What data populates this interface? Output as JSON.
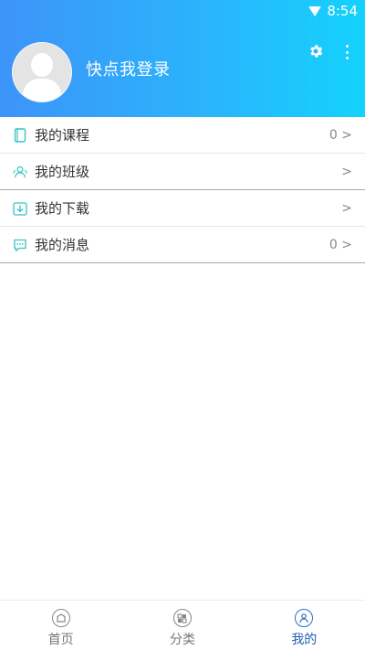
{
  "status_bar": {
    "time": "8:54"
  },
  "profile": {
    "login_prompt": "快点我登录"
  },
  "menu_items": [
    {
      "label": "我的课程",
      "count": "0",
      "arrow": ">"
    },
    {
      "label": "我的班级",
      "count": "",
      "arrow": ">"
    },
    {
      "label": "我的下载",
      "count": "",
      "arrow": ">"
    },
    {
      "label": "我的消息",
      "count": "0",
      "arrow": ">"
    }
  ],
  "tabs": [
    {
      "label": "首页"
    },
    {
      "label": "分类"
    },
    {
      "label": "我的"
    }
  ],
  "colors": {
    "header_gradient_start": "#3d94f9",
    "header_gradient_end": "#14d2fd",
    "icon_teal": "#36c3c3",
    "active_tab": "#1f5fb3"
  }
}
